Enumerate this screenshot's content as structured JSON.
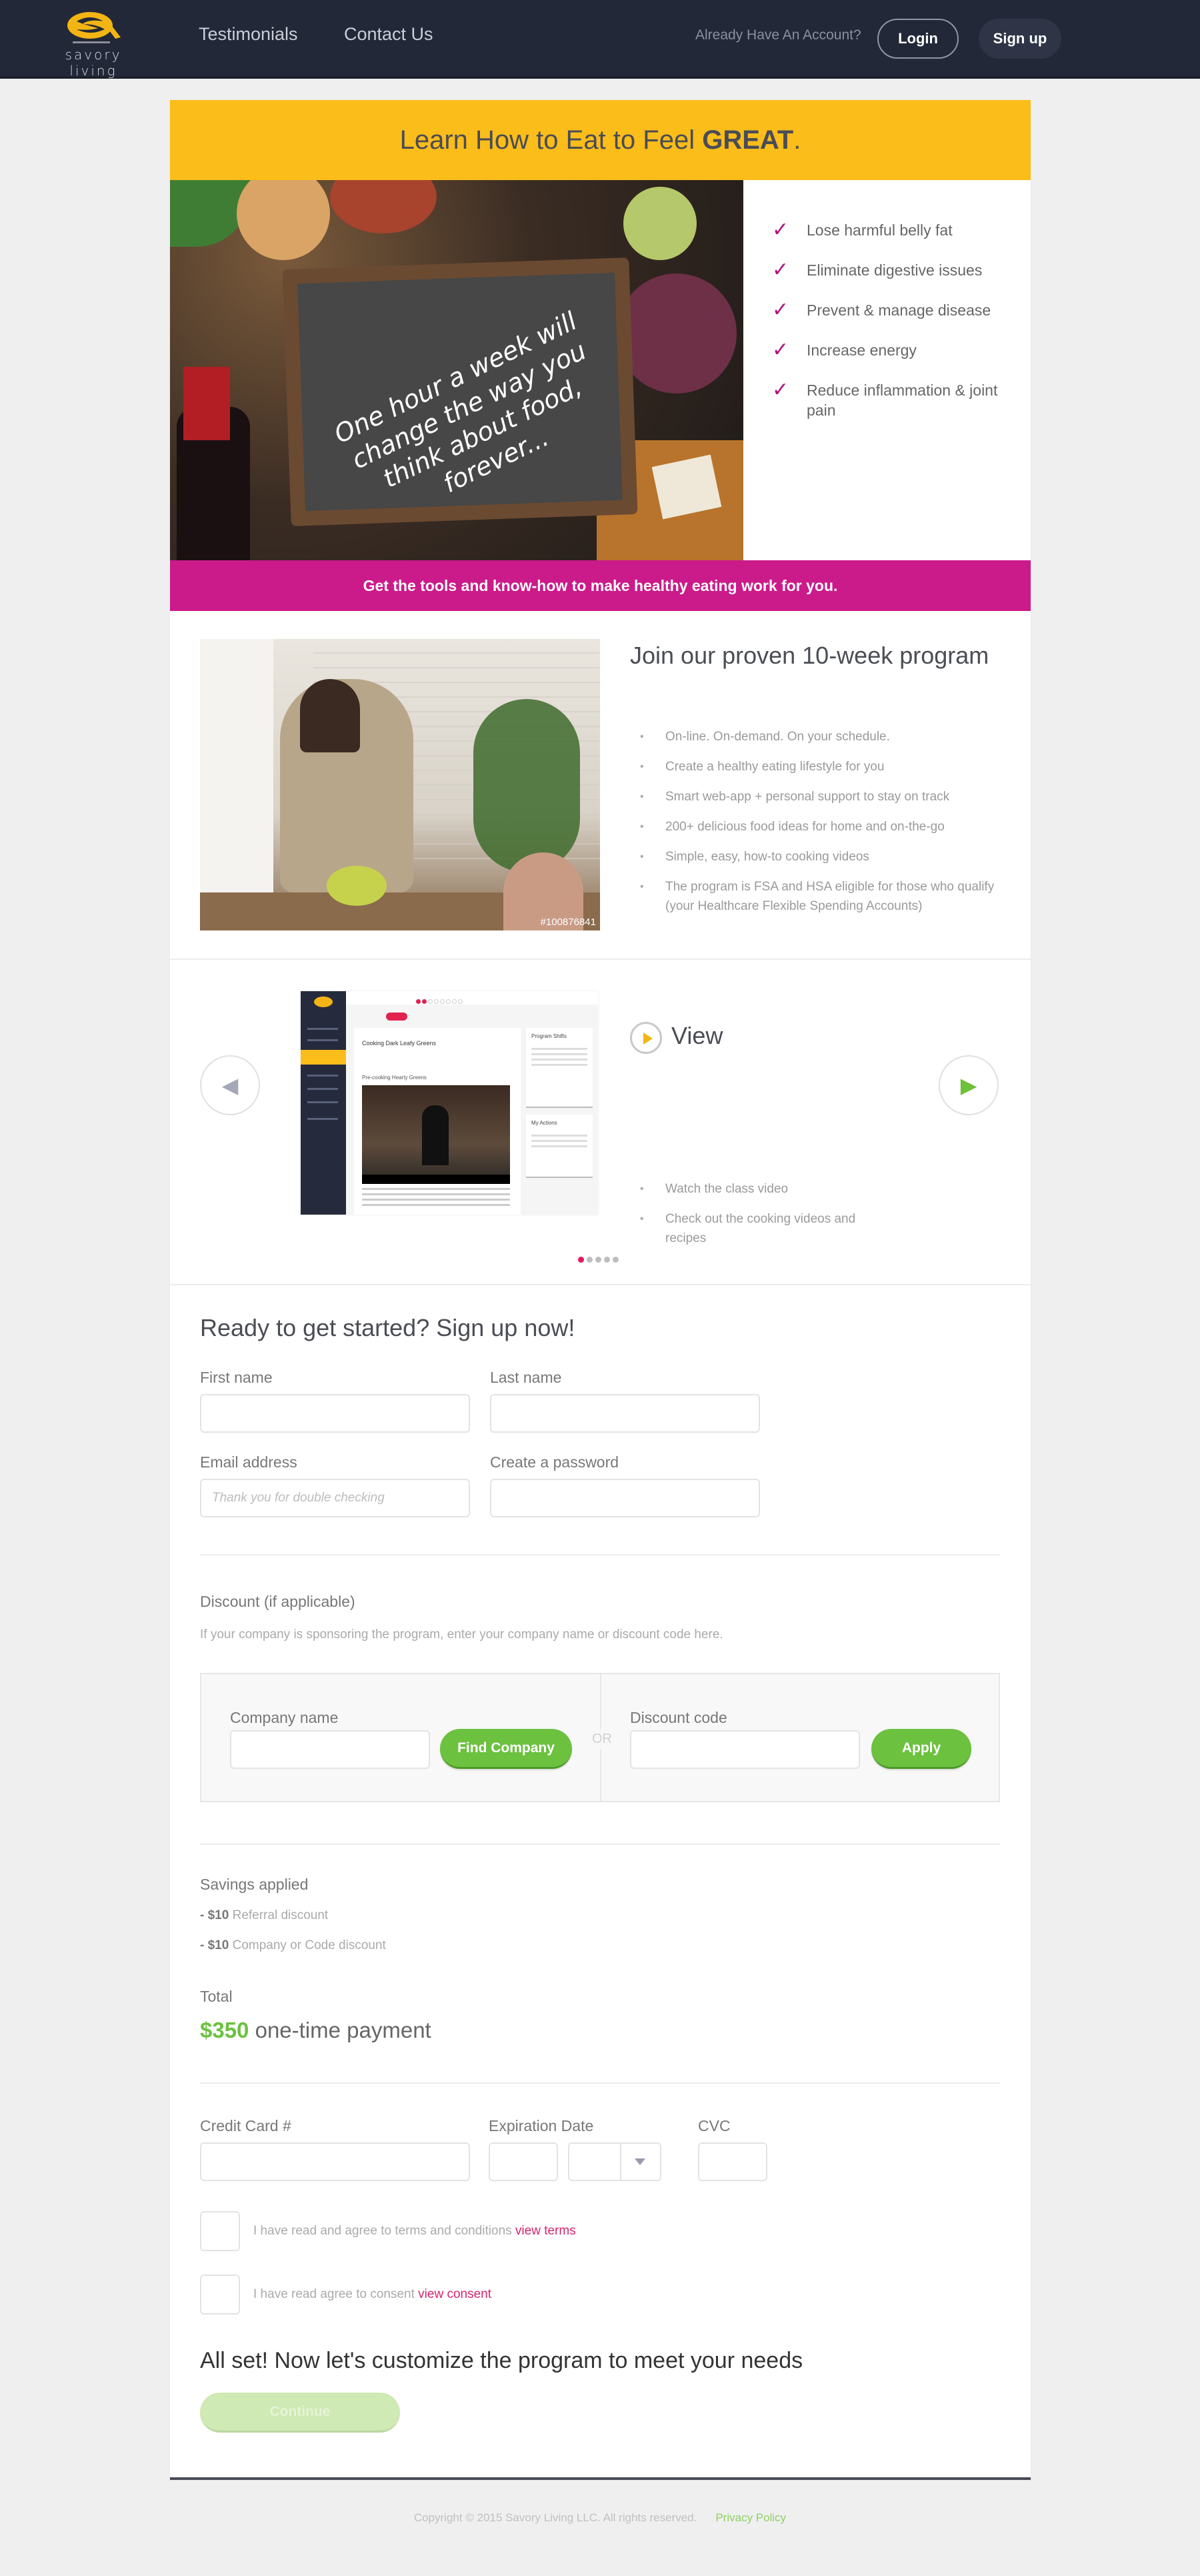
{
  "header": {
    "brand": "savory living",
    "nav": [
      {
        "label": "Testimonials"
      },
      {
        "label": "Contact Us"
      }
    ],
    "account_prompt": "Already Have An Account?",
    "login_label": "Login",
    "signup_label": "Sign up"
  },
  "hero": {
    "banner_prefix": "Learn How to Eat to Feel ",
    "banner_emphasis": "GREAT",
    "banner_suffix": ".",
    "chalkboard_text": "One hour a week will change the way you think about food, forever...",
    "benefits": [
      {
        "icon": "checkmark-icon",
        "label": "Lose harmful belly fat"
      },
      {
        "icon": "checkmark-icon",
        "label": "Eliminate digestive issues"
      },
      {
        "icon": "checkmark-icon",
        "label": "Prevent & manage disease"
      },
      {
        "icon": "checkmark-icon",
        "label": "Increase energy"
      },
      {
        "icon": "checkmark-icon",
        "label": "Reduce inflammation & joint pain"
      }
    ],
    "tagline": "Get the tools and know-how to make healthy eating work for you."
  },
  "program": {
    "photo_id": "#100876841",
    "title": "Join our proven 10-week program",
    "items": [
      "On-line. On-demand. On your schedule.",
      "Create a healthy eating lifestyle for you",
      "Smart web-app + personal support to stay on track",
      "200+ delicious food ideas for home and on-the-go",
      "Simple, easy, how-to cooking videos",
      "The program is FSA and HSA eligible for those who qualify (your Healthcare Flexible Spending Accounts)"
    ]
  },
  "carousel": {
    "mockup": {
      "title": "Cooking Dark Leafy Greens",
      "subtitle": "Pre-cooking Hearty Greens",
      "panel1_title": "Program Shifts",
      "panel2_title": "My Actions"
    },
    "slide_icon": "play-icon",
    "slide_title": "View",
    "slide_items": [
      "Watch the class video",
      "Check out the cooking videos and recipes"
    ],
    "total_slides": 5,
    "active_slide": 1
  },
  "signup": {
    "title": "Ready to get started? Sign up now!",
    "first_name": {
      "label": "First name",
      "value": "",
      "placeholder": ""
    },
    "last_name": {
      "label": "Last name",
      "value": "",
      "placeholder": ""
    },
    "email": {
      "label": "Email address",
      "value": "",
      "placeholder": "Thank you for double checking"
    },
    "password": {
      "label": "Create a password",
      "value": "",
      "placeholder": ""
    }
  },
  "discount": {
    "title": "Discount (if applicable)",
    "hint": "If your company is sponsoring the program, enter your company name or discount code here.",
    "company_label": "Company name",
    "company_value": "",
    "find_company_label": "Find Company",
    "or_label": "OR",
    "code_label": "Discount code",
    "code_value": "",
    "apply_label": "Apply"
  },
  "savings": {
    "title": "Savings applied",
    "items": [
      {
        "amount": "- $10",
        "label": " Referral discount"
      },
      {
        "amount": "- $10",
        "label": " Company or Code discount"
      }
    ],
    "total_label": "Total",
    "total_amount": "$350",
    "total_suffix": " one-time payment"
  },
  "payment": {
    "card_label": "Credit Card #",
    "card_value": "",
    "expiration_label": "Expiration Date",
    "exp_month_value": "",
    "exp_year_value": "",
    "cvc_label": "CVC",
    "cvc_value": ""
  },
  "agreements": [
    {
      "text": "I have read and agree to terms and conditions ",
      "link": "view terms",
      "checked": false
    },
    {
      "text": "I have read agree to consent ",
      "link": "view consent",
      "checked": false
    }
  ],
  "final": {
    "title": "All set! Now let's customize the program to meet your needs",
    "continue_label": "Continue"
  },
  "footer": {
    "copyright": "Copyright © 2015 Savory Living LLC. All rights reserved.",
    "privacy_label": "Privacy Policy"
  },
  "colors": {
    "header_bg": "#232838",
    "accent_yellow": "#fbbd1a",
    "accent_magenta": "#cb1a8a",
    "accent_green": "#6cc13f",
    "link_pink": "#d6246e"
  }
}
